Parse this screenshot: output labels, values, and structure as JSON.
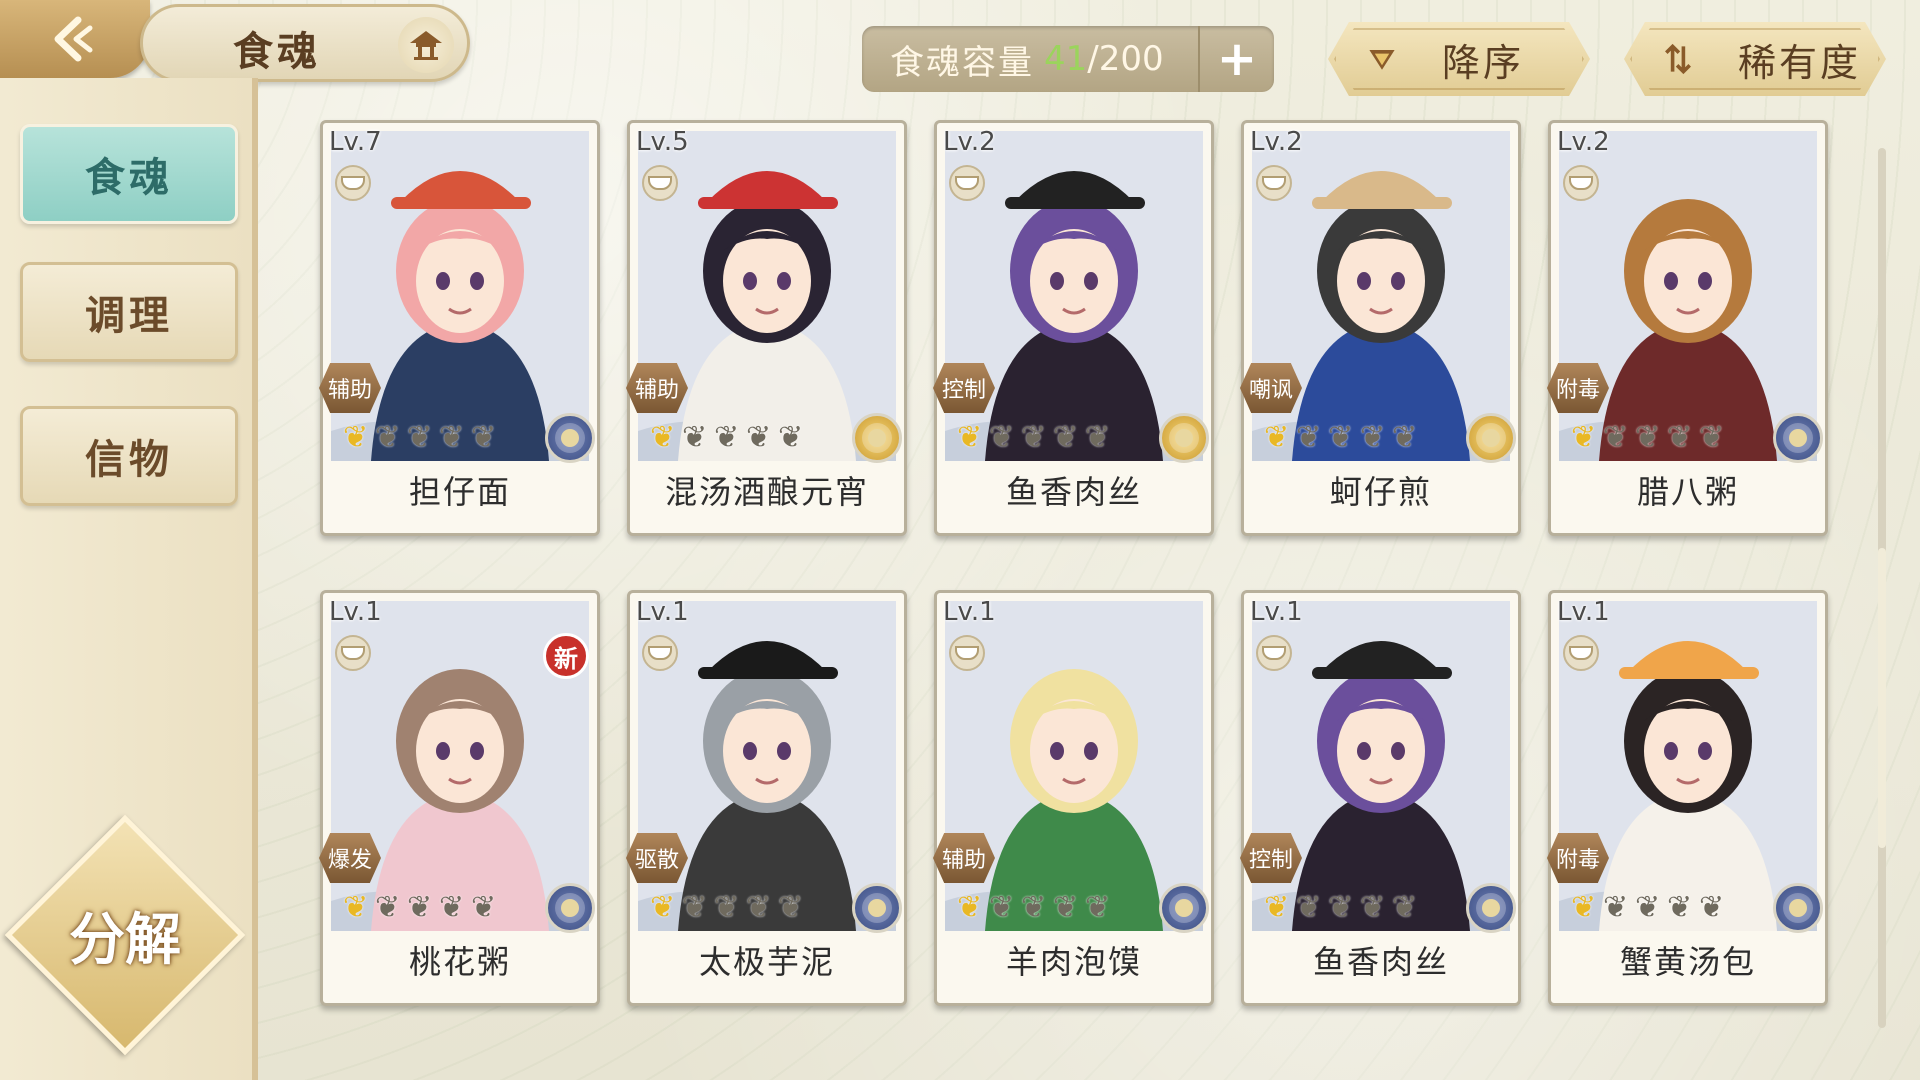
{
  "header": {
    "title": "食魂",
    "capacity_label": "食魂容量",
    "capacity_current": "41",
    "capacity_sep": "/",
    "capacity_max": "200",
    "add_icon": "plus-icon",
    "sort_order": "降序",
    "sort_by": "稀有度"
  },
  "sidebar": {
    "tabs": [
      {
        "label": "食魂",
        "active": true
      },
      {
        "label": "调理",
        "active": false
      },
      {
        "label": "信物",
        "active": false
      }
    ],
    "decompose_label": "分解"
  },
  "colors": {
    "capacity_green": "#9bd45c",
    "active_tab": "#8ecfc4",
    "gold": "#e9b824",
    "new_badge": "#c8312b"
  },
  "cards": [
    {
      "level": "Lv.7",
      "role": "辅助",
      "name": "担仔面",
      "stars_gold": 1,
      "stars_total": 5,
      "rarity": "blue",
      "new": false,
      "hair": "#f2a7a7",
      "coat": "#2b3e63",
      "hat": "#d8553a"
    },
    {
      "level": "Lv.5",
      "role": "辅助",
      "name": "混汤酒酿元宵",
      "stars_gold": 1,
      "stars_total": 5,
      "rarity": "gold",
      "new": false,
      "hair": "#2a2433",
      "coat": "#f2efe9",
      "hat": "#c33"
    },
    {
      "level": "Lv.2",
      "role": "控制",
      "name": "鱼香肉丝",
      "stars_gold": 1,
      "stars_total": 5,
      "rarity": "gold",
      "new": false,
      "hair": "#6b4f9c",
      "coat": "#2a2230",
      "hat": "#222"
    },
    {
      "level": "Lv.2",
      "role": "嘲讽",
      "name": "蚵仔煎",
      "stars_gold": 1,
      "stars_total": 5,
      "rarity": "gold",
      "new": false,
      "hair": "#3a3a3a",
      "coat": "#2c4b9b",
      "hat": "#d9b98a"
    },
    {
      "level": "Lv.2",
      "role": "附毒",
      "name": "腊八粥",
      "stars_gold": 1,
      "stars_total": 5,
      "rarity": "blue",
      "new": false,
      "hair": "#b57a3d",
      "coat": "#6e2a2a",
      "hat": ""
    },
    {
      "level": "Lv.1",
      "role": "爆发",
      "name": "桃花粥",
      "stars_gold": 1,
      "stars_total": 5,
      "rarity": "blue",
      "new": true,
      "new_label": "新",
      "hair": "#a08270",
      "coat": "#f0c7cf",
      "hat": ""
    },
    {
      "level": "Lv.1",
      "role": "驱散",
      "name": "太极芋泥",
      "stars_gold": 1,
      "stars_total": 5,
      "rarity": "blue",
      "new": false,
      "hair": "#9aa0a6",
      "coat": "#3a3a3a",
      "hat": "#1a1a1a"
    },
    {
      "level": "Lv.1",
      "role": "辅助",
      "name": "羊肉泡馍",
      "stars_gold": 1,
      "stars_total": 5,
      "rarity": "blue",
      "new": false,
      "hair": "#f0e1a0",
      "coat": "#3f8a4a",
      "hat": ""
    },
    {
      "level": "Lv.1",
      "role": "控制",
      "name": "鱼香肉丝",
      "stars_gold": 1,
      "stars_total": 5,
      "rarity": "blue",
      "new": false,
      "hair": "#6b4f9c",
      "coat": "#2a2230",
      "hat": "#222"
    },
    {
      "level": "Lv.1",
      "role": "附毒",
      "name": "蟹黄汤包",
      "stars_gold": 1,
      "stars_total": 5,
      "rarity": "blue",
      "new": false,
      "hair": "#2b2424",
      "coat": "#f5f1ea",
      "hat": "#f0a54a"
    }
  ]
}
